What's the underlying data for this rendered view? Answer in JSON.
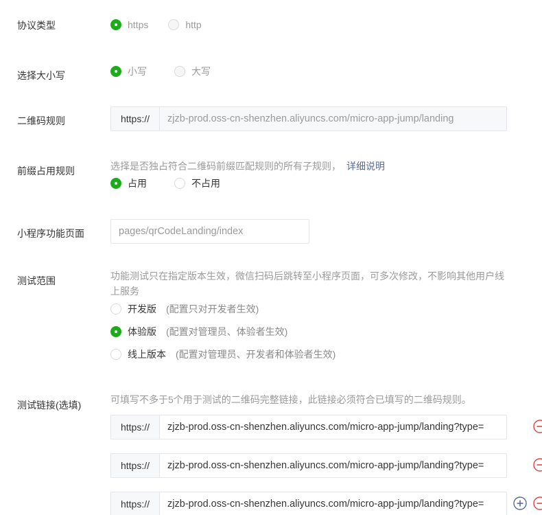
{
  "protocol": {
    "label": "协议类型",
    "options": [
      {
        "label": "https",
        "checked": true
      },
      {
        "label": "http",
        "checked": false
      }
    ]
  },
  "case": {
    "label": "选择大小写",
    "options": [
      {
        "label": "小写",
        "checked": true
      },
      {
        "label": "大写",
        "checked": false
      }
    ]
  },
  "qr_rule": {
    "label": "二维码规则",
    "prefix": "https://",
    "value": "zjzb-prod.oss-cn-shenzhen.aliyuncs.com/micro-app-jump/landing"
  },
  "prefix_occupy": {
    "label": "前缀占用规则",
    "hint": "选择是否独占符合二维码前缀匹配规则的所有子规则，",
    "link": "详细说明",
    "options": [
      {
        "label": "占用",
        "checked": true
      },
      {
        "label": "不占用",
        "checked": false
      }
    ]
  },
  "page": {
    "label": "小程序功能页面",
    "placeholder": "pages/qrCodeLanding/index"
  },
  "test_scope": {
    "label": "测试范围",
    "hint_line1": "功能测试只在指定版本生效，微信扫码后跳转至小程序页面，可多次修改，不影响其他用户线",
    "hint_line2": "上服务",
    "options": [
      {
        "label": "开发版",
        "note": "(配置只对开发者生效)",
        "checked": false
      },
      {
        "label": "体验版",
        "note": "(配置对管理员、体验者生效)",
        "checked": true
      },
      {
        "label": "线上版本",
        "note": "(配置对管理员、开发者和体验者生效)",
        "checked": false
      }
    ]
  },
  "test_links": {
    "label": "测试链接(选填)",
    "hint": "可填写不多于5个用于测试的二维码完整链接，此链接必须符合已填写的二维码规则。",
    "links": [
      {
        "prefix": "https://",
        "value": "zjzb-prod.oss-cn-shenzhen.aliyuncs.com/micro-app-jump/landing?type="
      },
      {
        "prefix": "https://",
        "value": "zjzb-prod.oss-cn-shenzhen.aliyuncs.com/micro-app-jump/landing?type="
      },
      {
        "prefix": "https://",
        "value": "zjzb-prod.oss-cn-shenzhen.aliyuncs.com/micro-app-jump/landing?type="
      }
    ],
    "add_icon": "plus-circle-icon",
    "remove_icon": "minus-circle-icon"
  },
  "colors": {
    "accent": "#1aad19",
    "link": "#576b95",
    "remove": "#e64340",
    "add": "#576b95"
  }
}
